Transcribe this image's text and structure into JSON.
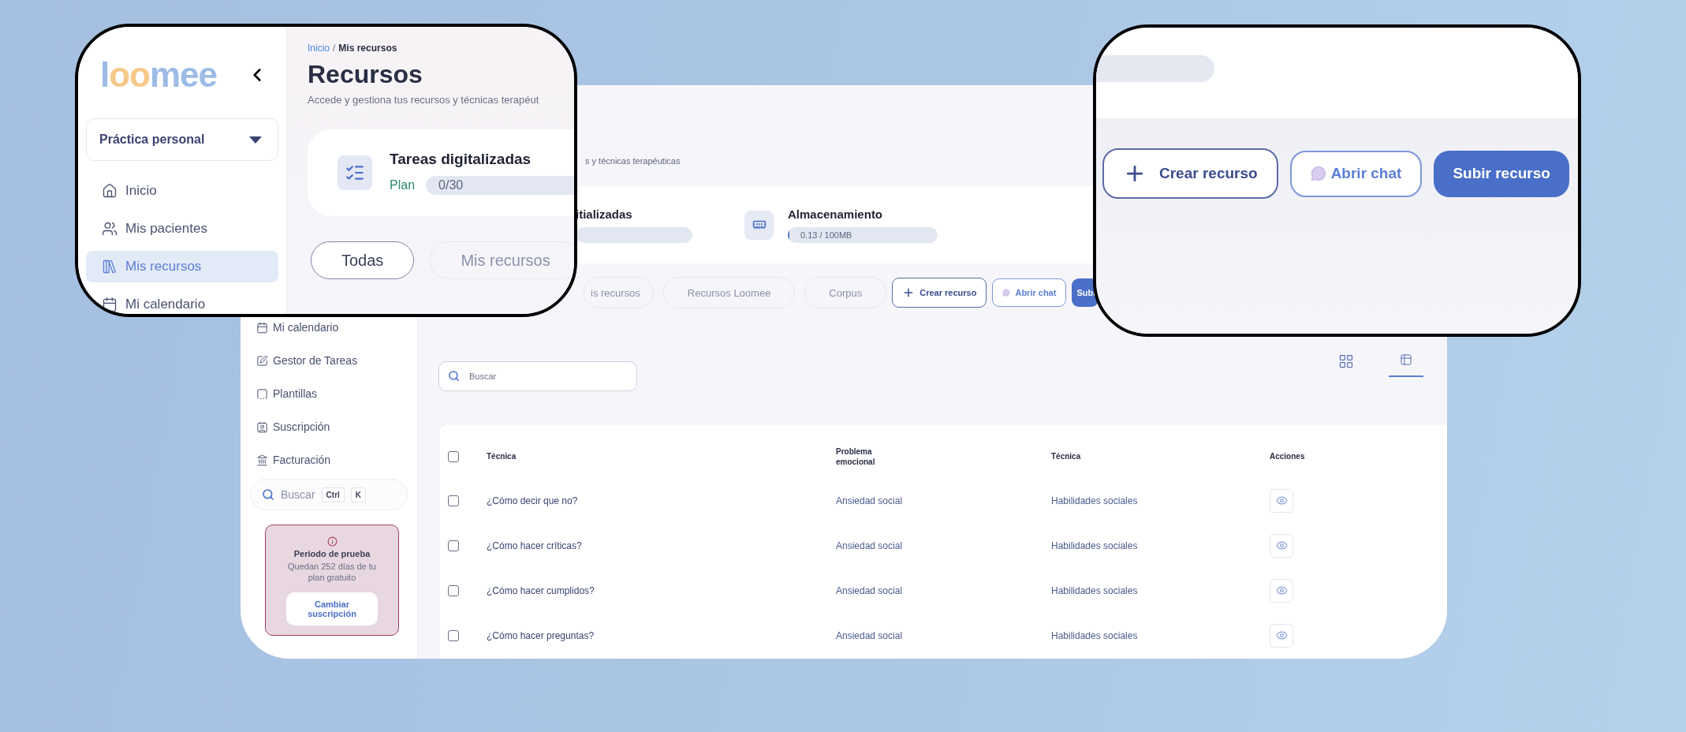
{
  "zoom_left": {
    "logo": [
      {
        "text": "l",
        "color": "#9dbbe6"
      },
      {
        "text": "oo",
        "color": "#f6c98a"
      },
      {
        "text": "mee",
        "color": "#9dbbe6"
      }
    ],
    "workspace": "Práctica personal",
    "nav": [
      {
        "kind": "home",
        "label": "Inicio",
        "selected": false
      },
      {
        "kind": "people",
        "label": "Mis pacientes",
        "selected": false
      },
      {
        "kind": "books",
        "label": "Mis recursos",
        "selected": true
      },
      {
        "kind": "calendar",
        "label": "Mi calendario",
        "selected": false
      }
    ],
    "breadcrumb": {
      "parent": "Inicio",
      "separator": "/",
      "current": "Mis recursos"
    },
    "title": "Recursos",
    "subtitle": "Accede y gestiona tus recursos y técnicas terapéut",
    "stat": {
      "title": "Tareas digitalizadas",
      "plan": "Plan",
      "usage": "0/30"
    },
    "tabs": [
      {
        "label": "Todas",
        "selected": true
      },
      {
        "label": "Mis recursos",
        "selected": false
      }
    ]
  },
  "zoom_right": {
    "buttons": [
      {
        "kind": "create",
        "label": "Crear recurso"
      },
      {
        "kind": "chat",
        "label": "Abrir chat"
      },
      {
        "kind": "upload",
        "label": "Subir recurso"
      }
    ]
  },
  "screen": {
    "nav": [
      {
        "kind": "calendar",
        "label": "Mi calendario",
        "selected": false
      },
      {
        "kind": "edit",
        "label": "Gestor de Tareas",
        "selected": false
      },
      {
        "kind": "template",
        "label": "Plantillas",
        "selected": false
      },
      {
        "kind": "subscription",
        "label": "Suscripción",
        "selected": false
      },
      {
        "kind": "billing",
        "label": "Facturación",
        "selected": false
      }
    ],
    "nav_search": {
      "placeholder": "Buscar",
      "keys": [
        "Ctrl",
        "K"
      ]
    },
    "trial": {
      "title": "Periodo de prueba",
      "text": "Quedan 252 días de tu plan gratuito",
      "action": "Cambiar suscripción"
    },
    "subtitle": "s y técnicas terapéuticas",
    "stats": [
      {
        "kind": "tasks",
        "title": "itializadas"
      },
      {
        "kind": "storage",
        "title": "Almacenamiento",
        "usage": "0.13 / 100MB",
        "level": 0.01
      }
    ],
    "tabs": [
      {
        "label": "is recursos",
        "selected": false
      },
      {
        "label": "Recursos Loomee",
        "selected": false
      },
      {
        "label": "Corpus",
        "selected": false
      }
    ],
    "buttons": [
      {
        "kind": "create",
        "label": "Crear recurso"
      },
      {
        "kind": "chat",
        "label": "Abrir chat"
      },
      {
        "kind": "upload",
        "label": "Subi"
      }
    ],
    "search": {
      "placeholder": "Buscar"
    },
    "views": [
      {
        "kind": "grid",
        "selected": false
      },
      {
        "kind": "list",
        "selected": true
      }
    ],
    "table": {
      "select_all": {
        "checked": false
      },
      "columns": [
        "Técnica",
        "Problema emocional",
        "Técnica",
        "Acciones"
      ],
      "rows": [
        {
          "checked": false,
          "cells": [
            "¿Cómo decir que no?",
            "Ansiedad social",
            "Habilidades sociales"
          ]
        },
        {
          "checked": false,
          "cells": [
            "¿Cómo hacer críticas?",
            "Ansiedad social",
            "Habilidades sociales"
          ]
        },
        {
          "checked": false,
          "cells": [
            "¿Cómo hacer cumplidos?",
            "Ansiedad social",
            "Habilidades sociales"
          ]
        },
        {
          "checked": false,
          "cells": [
            "¿Cómo hacer preguntas?",
            "Ansiedad social",
            "Habilidades sociales"
          ]
        }
      ]
    }
  }
}
